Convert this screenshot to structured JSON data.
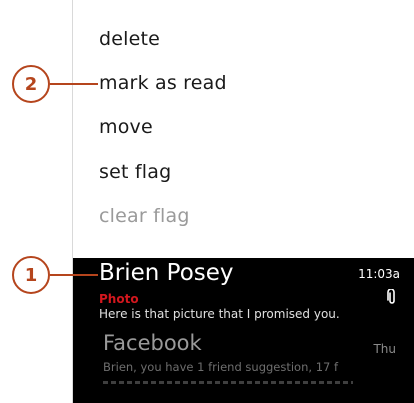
{
  "context_menu": {
    "items": [
      {
        "label": "delete",
        "enabled": true
      },
      {
        "label": "mark as read",
        "enabled": true
      },
      {
        "label": "move",
        "enabled": true
      },
      {
        "label": "set flag",
        "enabled": true
      },
      {
        "label": "clear flag",
        "enabled": false
      }
    ]
  },
  "inbox": {
    "emails": [
      {
        "sender": "Brien Posey",
        "subject": "Photo",
        "preview": "Here is that picture that I promised you.",
        "time": "11:03a",
        "has_attachment": true,
        "attachment_icon": "paperclip-icon"
      },
      {
        "sender": "Facebook",
        "preview": "Brien, you have 1 friend suggestion, 17 f",
        "time": "Thu"
      }
    ]
  },
  "callouts": {
    "one": "1",
    "two": "2"
  },
  "colors": {
    "callout": "#b5451d",
    "subject": "#d4171e",
    "list_background": "#000000"
  }
}
